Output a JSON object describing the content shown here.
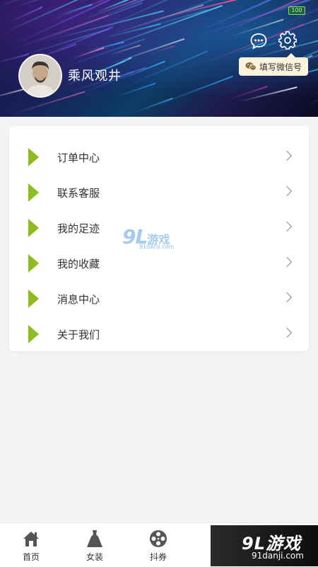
{
  "status_bar": {
    "battery": "100"
  },
  "profile": {
    "username": "乘风观井",
    "wechat_button": "填写微信号"
  },
  "menu": [
    {
      "label": "订单中心"
    },
    {
      "label": "联系客服"
    },
    {
      "label": "我的足迹"
    },
    {
      "label": "我的收藏"
    },
    {
      "label": "消息中心"
    },
    {
      "label": "关于我们"
    }
  ],
  "watermark": {
    "logo": "9L",
    "cn": "游戏",
    "site": "91danji.com"
  },
  "tabbar": [
    {
      "label": "首页",
      "icon": "home-icon"
    },
    {
      "label": "女装",
      "icon": "dress-icon"
    },
    {
      "label": "抖券",
      "icon": "film-reel-icon"
    }
  ],
  "brand_corner": {
    "logo": "9L游戏",
    "site": "91danji.com"
  },
  "colors": {
    "accent": "#8dbb25",
    "header_dark": "#101038",
    "pill_bg": "#fdf3dc"
  }
}
